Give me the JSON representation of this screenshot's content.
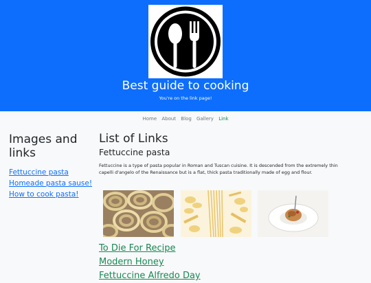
{
  "header": {
    "title": "Best guide to cooking",
    "subtitle": "You're on the link page!",
    "logo_icon": "spoon-fork-icon"
  },
  "nav": {
    "items": [
      "Home",
      "About",
      "Blog",
      "Gallery",
      "Link"
    ],
    "active": "Link"
  },
  "sidebar": {
    "heading": "Images and links",
    "links": [
      "Fettuccine pasta",
      "Homeade pasta sause!",
      "How to cook pasta!"
    ]
  },
  "main": {
    "heading": "List of Links",
    "subheading": "Fettuccine pasta",
    "description": "Fettuccine is a type of pasta popular in Roman and Tuscan cuisine. It is descended from the extremely thin capelli d'angelo of the Renaissance but is a flat, thick pasta traditionally made of egg and flour.",
    "images": [
      "pasta-nests-photo",
      "dried-pasta-photo",
      "pasta-plate-photo"
    ],
    "links": [
      "To Die For Recipe",
      "Modern Honey",
      "Fettuccine Alfredo Day"
    ]
  },
  "colors": {
    "header_bg": "#0d6efd",
    "nav_active": "#198754",
    "sidebar_link": "#0d6efd",
    "main_link": "#198754"
  }
}
